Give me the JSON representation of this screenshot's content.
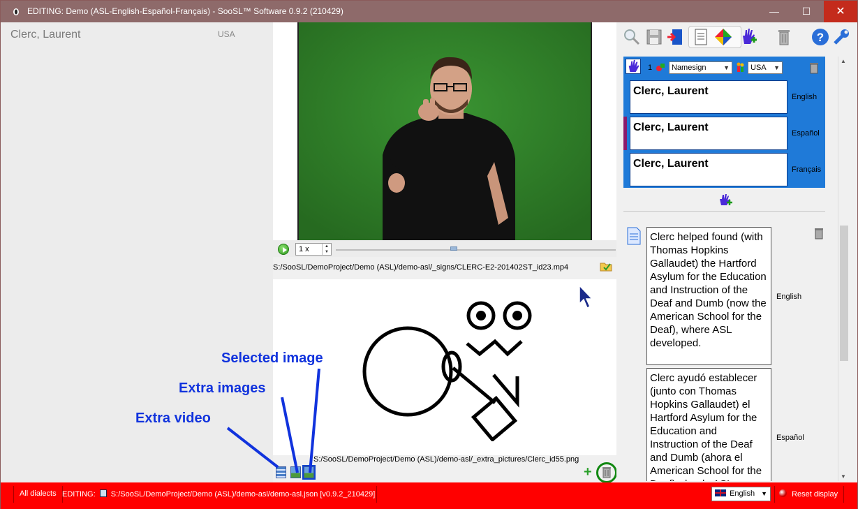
{
  "window": {
    "title": "EDITING: Demo (ASL-English-Español-Français) - SooSL™ Software 0.9.2 (210429)",
    "minimize_label": "—",
    "maximize_label": "☐",
    "close_label": "✕"
  },
  "sign_list": {
    "items": [
      {
        "gloss": "Clerc, Laurent",
        "dialect": "USA"
      }
    ]
  },
  "video": {
    "speed": "1 x",
    "path": "S:/SooSL/DemoProject/Demo (ASL)/demo-asl/_signs/CLERC-E2-201402ST_id23.mp4"
  },
  "extra_media": {
    "image_path": "S:/SooSL/DemoProject/Demo (ASL)/demo-asl/_extra_pictures/Clerc_id55.png"
  },
  "sense": {
    "number": "1",
    "grammar_category": "Namesign",
    "dialect": "USA",
    "glosses": [
      {
        "text": "Clerc, Laurent",
        "language": "English"
      },
      {
        "text": "Clerc, Laurent",
        "language": "Español"
      },
      {
        "text": "Clerc, Laurent",
        "language": "Français"
      }
    ]
  },
  "notes": [
    {
      "text": "Clerc helped found (with Thomas Hopkins Gallaudet) the Hartford Asylum for the Education and Instruction of the Deaf and Dumb (now the American School for the Deaf), where ASL developed.",
      "language": "English"
    },
    {
      "text": "Clerc ayudó establecer (junto con Thomas Hopkins Gallaudet) el Hartford Asylum for the Education and Instruction of the Deaf and Dumb (ahora el American School for the Deaf), donde ASL se desarrolló.",
      "language": "Español"
    }
  ],
  "statusbar": {
    "dialects": "All dialects",
    "editing_label": "EDITING:",
    "project_path": "S:/SooSL/DemoProject/Demo (ASL)/demo-asl/demo-asl.json [v0.9.2_210429]",
    "interface_language": "English",
    "reset_display": "Reset display"
  },
  "annotations": {
    "selected_image": "Selected image",
    "extra_images": "Extra images",
    "extra_video": "Extra video"
  },
  "colors": {
    "titlebar": "#8e6a6a",
    "sense_background": "#1f7ad8",
    "statusbar": "#ff0000",
    "annotation": "#1133dd",
    "video_greenscreen": "#2f7c28"
  },
  "icons": {
    "toolbar": [
      "search-icon",
      "save-icon",
      "exit-edit-icon",
      "sign-info-icon",
      "component-wheel-icon",
      "add-sign-icon",
      "delete-sign-icon",
      "help-icon",
      "settings-wrench-icon"
    ]
  }
}
